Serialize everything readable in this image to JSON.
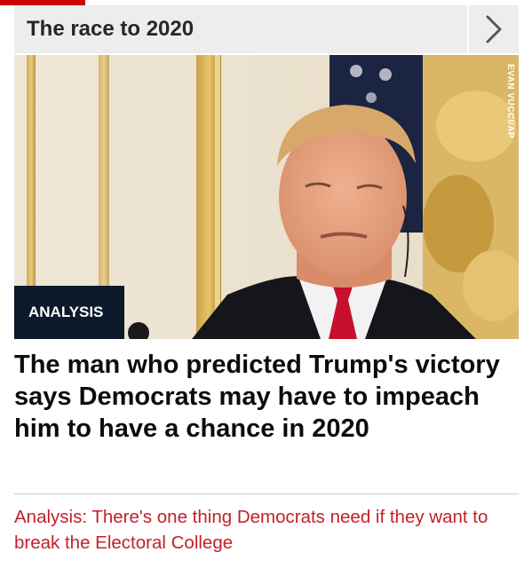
{
  "section": {
    "title": "The race to 2020",
    "next_icon": "chevron-right-icon"
  },
  "hero": {
    "photo_credit": "EVAN VUCCI/AP",
    "badge": "ANALYSIS"
  },
  "article": {
    "headline": "The man who predicted Trump's victory says Democrats may have to impeach him to have a chance in 2020",
    "related_link": "Analysis: There's one thing Democrats need if they want to break the Electoral College"
  },
  "colors": {
    "accent_red": "#cc0000",
    "link_red": "#c4202a",
    "badge_navy": "#0c1a2b",
    "header_gray": "#ededed"
  }
}
